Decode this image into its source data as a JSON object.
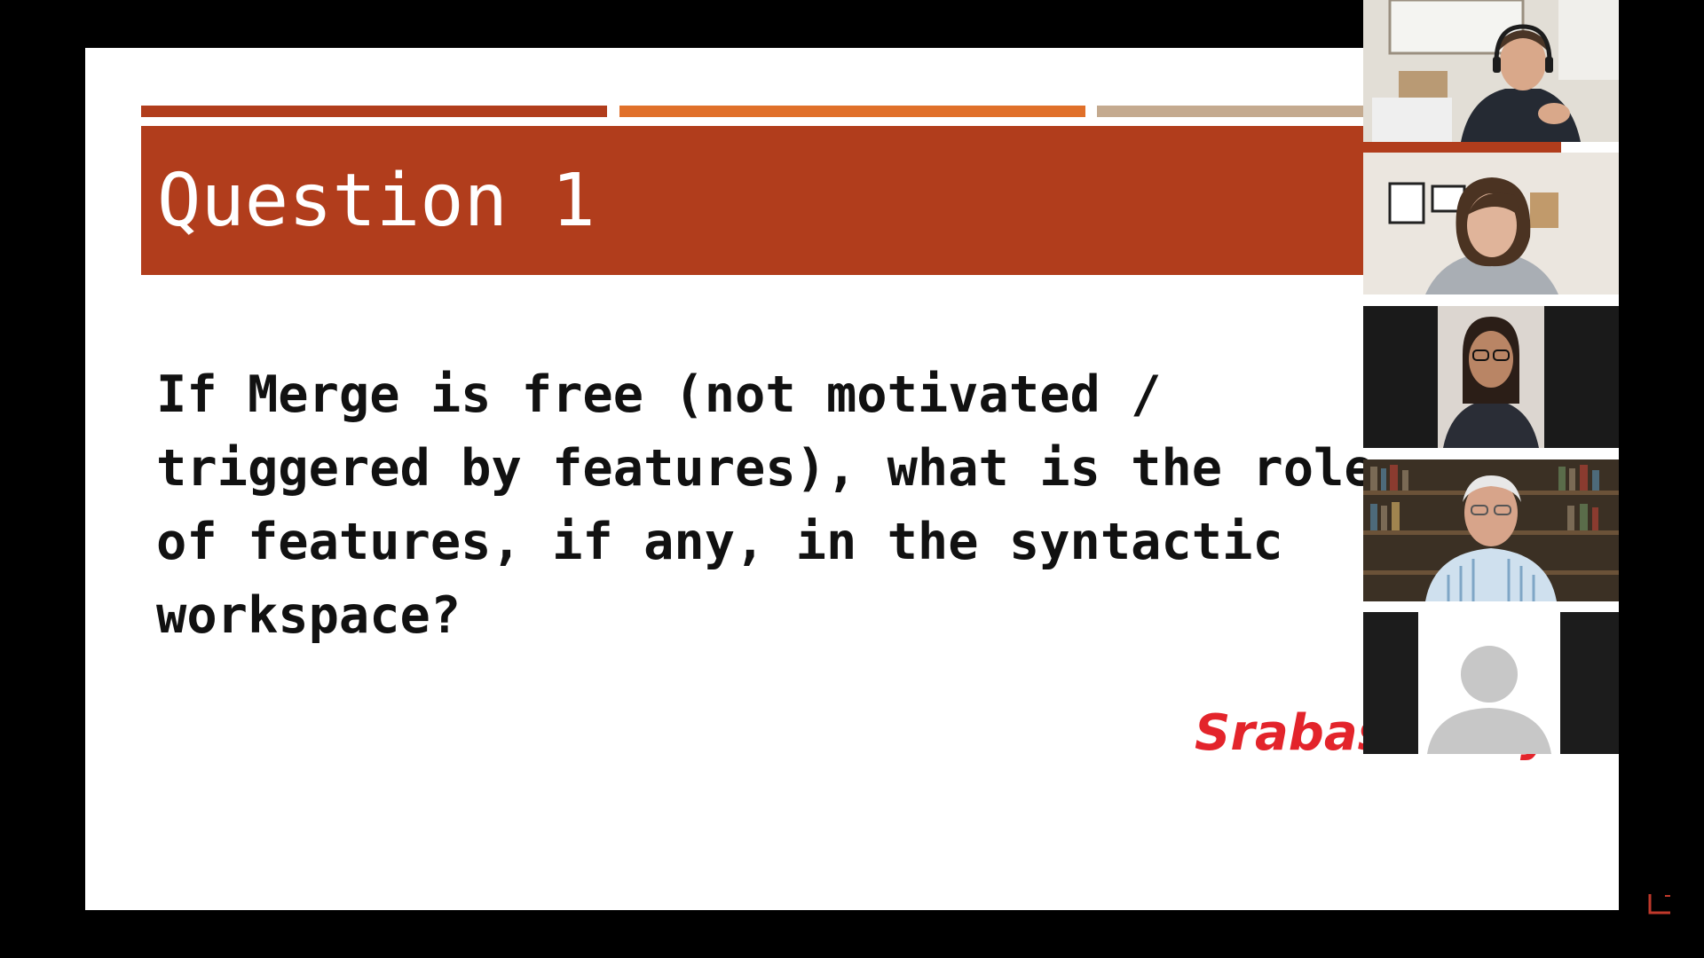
{
  "slide": {
    "title": "Question 1",
    "question_lines": [
      "If Merge is free (not motivated /",
      "triggered by features), what is the role",
      "of features, if any, in the syntactic",
      "workspace?"
    ],
    "presenter_name": "Srabasti Dey"
  },
  "colors": {
    "title_band": "#b13d1c",
    "accent_1": "#b13d1c",
    "accent_2": "#e0702a",
    "accent_3": "#c4aa8f",
    "presenter_name": "#e3242b"
  },
  "gallery": {
    "tiles": [
      {
        "name": "participant-video-1",
        "kind": "video"
      },
      {
        "name": "participant-video-2",
        "kind": "video"
      },
      {
        "name": "participant-video-3",
        "kind": "video"
      },
      {
        "name": "participant-video-4",
        "kind": "video"
      },
      {
        "name": "participant-avatar-5",
        "kind": "avatar-placeholder"
      }
    ]
  }
}
